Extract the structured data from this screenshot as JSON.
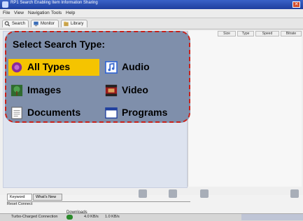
{
  "window": {
    "title": "RP1 Search Enabling Item Information Sharing"
  },
  "menu": {
    "items": [
      "File",
      "View",
      "Navigation",
      "Tools",
      "Help"
    ]
  },
  "tabs": [
    {
      "label": "Search"
    },
    {
      "label": "Monitor"
    },
    {
      "label": "Library"
    }
  ],
  "table_headers": [
    "Size",
    "Type",
    "Speed",
    "Bitrate"
  ],
  "search_popup": {
    "heading": "Select Search Type:",
    "options": [
      {
        "label": "All Types",
        "icon": "all-types-icon",
        "selected": true
      },
      {
        "label": "Audio",
        "icon": "audio-icon",
        "selected": false
      },
      {
        "label": "Images",
        "icon": "images-icon",
        "selected": false
      },
      {
        "label": "Video",
        "icon": "video-icon",
        "selected": false
      },
      {
        "label": "Documents",
        "icon": "documents-icon",
        "selected": false
      },
      {
        "label": "Programs",
        "icon": "programs-icon",
        "selected": false
      }
    ]
  },
  "bottom_tabs": [
    {
      "label": "Keyword"
    },
    {
      "label": "What's New"
    }
  ],
  "reset": {
    "label": "Reset Connect"
  },
  "downloads": {
    "label": "Downloads"
  },
  "status": {
    "connection": "Turbo-Charged Connection",
    "down": "4.0 KB/s",
    "up": "1.0 KB/s"
  },
  "colors": {
    "accent": "#f5c400",
    "popup_bg": "#7f8fab",
    "border": "#c8221b"
  }
}
